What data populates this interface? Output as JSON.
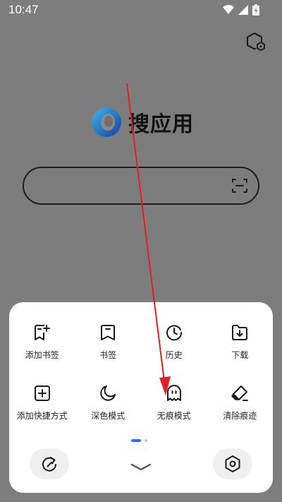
{
  "status_bar": {
    "time": "10:47",
    "icons": [
      "wifi-icon",
      "cellular-icon",
      "battery-charging-icon"
    ]
  },
  "app": {
    "name": "搜应用",
    "top_icon": "shield-hexagon-icon"
  },
  "search": {
    "placeholder": "",
    "value": "",
    "scan_icon": "scan-icon"
  },
  "menu": {
    "rows": [
      [
        {
          "label": "添加书签",
          "icon": "bookmark-add-icon"
        },
        {
          "label": "书签",
          "icon": "bookmark-icon"
        },
        {
          "label": "历史",
          "icon": "history-clock-icon"
        },
        {
          "label": "下载",
          "icon": "download-folder-icon"
        }
      ],
      [
        {
          "label": "添加快捷方式",
          "icon": "add-shortcut-icon"
        },
        {
          "label": "深色模式",
          "icon": "moon-icon"
        },
        {
          "label": "无痕模式",
          "icon": "ghost-icon"
        },
        {
          "label": "清除痕迹",
          "icon": "eraser-icon"
        }
      ]
    ],
    "page_indicator": {
      "current": 1,
      "total": 2
    },
    "bottom_buttons": {
      "left_icon": "refresh-icon",
      "center_icon": "chevron-down-icon",
      "right_icon": "settings-hexagon-icon"
    }
  },
  "colors": {
    "background": "#7d7d7d",
    "sheet": "#ffffff",
    "accent": "#2b6ff2",
    "annotation_arrow": "#e02020"
  }
}
